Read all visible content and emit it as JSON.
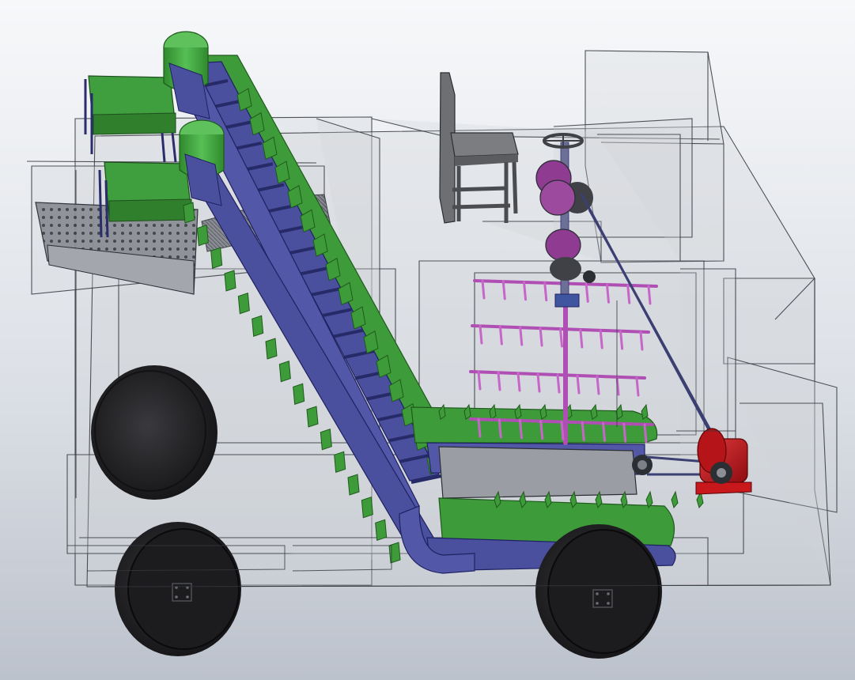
{
  "view": {
    "background_top": "#f7f8fa",
    "background_bottom": "#bcc2cc"
  },
  "colors": {
    "housing_fill": "#d3d7dc",
    "housing_edge": "#3a3d44",
    "conveyor_frame": "#4a4f9e",
    "conveyor_frame_dark": "#2e3170",
    "paddle_green": "#3e9b3a",
    "paddle_green_dark": "#24661f",
    "drum_green": "#45a843",
    "seat_gray": "#6d6f72",
    "rack_purple": "#b04fb3",
    "motor_red": "#c8181c",
    "tire": "#1c1c1e",
    "tire_side": "#2b2b2e",
    "grate": "#7d8086",
    "steering": "#3f4147"
  },
  "components": {
    "wheels": [
      "rear-wheel",
      "front-wheel",
      "spare-wheel"
    ],
    "motor": "electric-motor",
    "seat": "operator-seat",
    "steering": "steering-wheel",
    "conveyor": "inclined-paddle-conveyor",
    "racks": "sorting-racks",
    "hopper": "grated-hopper"
  }
}
